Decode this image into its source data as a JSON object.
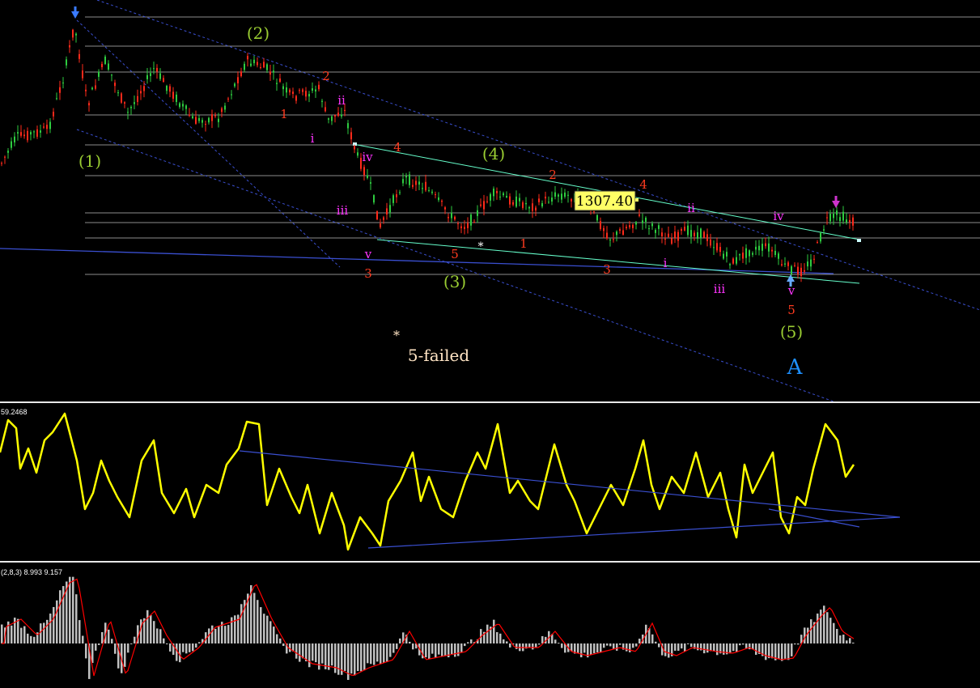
{
  "chart_data": [
    {
      "type": "candlestick",
      "price_label": "1307.40",
      "trendlines": "descending dashed blue channel; green wedge lines",
      "colors": {
        "up": "#2ecc40",
        "down": "#ff2a1a",
        "wave_primary": "#9acd32",
        "wave_red": "#ff3b1f",
        "wave_magenta": "#ff33ff",
        "wave_blue": "#1e90ff",
        "annotation": "#ffe4c4"
      },
      "annotations": {
        "p1": "(1)",
        "p2": "(2)",
        "p3": "(3)",
        "p4": "(4)",
        "p5": "(5)",
        "pA": "A",
        "r_1a": "1",
        "r_2a": "2",
        "r_3a": "3",
        "r_4a": "4",
        "r_5a": "5",
        "r_1b": "1",
        "r_2b": "2",
        "r_3b": "3",
        "r_4b": "4",
        "r_5b": "5",
        "m_ia": "i",
        "m_iia": "ii",
        "m_iiia": "iii",
        "m_iva": "iv",
        "m_va": "v",
        "m_ib": "i",
        "m_iib": "ii",
        "m_iiib": "iii",
        "m_ivb": "iv",
        "m_vb": "v",
        "failed": "5-failed",
        "star": "*"
      }
    },
    {
      "type": "line",
      "label": "59.2468",
      "color": "#ffff00"
    },
    {
      "type": "bar",
      "label": "(2,8,3) 8.993 9.157",
      "bar_color": "#c0c0c0",
      "signal_color": "#ff0000"
    }
  ]
}
